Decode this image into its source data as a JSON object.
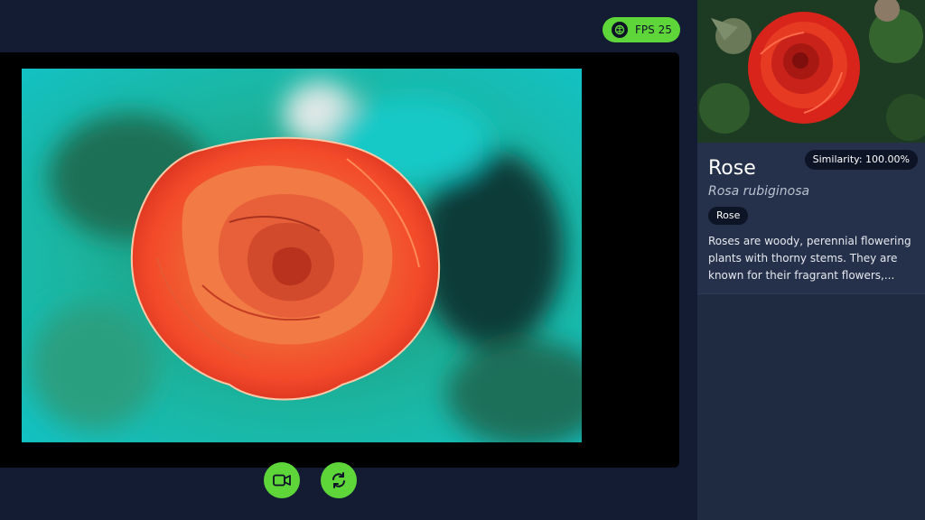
{
  "status": {
    "fps_label": "FPS 25",
    "icon": "brain-icon"
  },
  "controls": {
    "camera_icon": "video-camera-icon",
    "switch_icon": "refresh-icon"
  },
  "result": {
    "similarity": "Similarity: 100.00%",
    "common_name": "Rose",
    "scientific_name": "Rosa rubiginosa",
    "tag": "Rose",
    "description": "Roses are woody, perennial flowering plants with thorny stems. They are known for their fragrant flowers,..."
  },
  "colors": {
    "accent": "#5ed63a",
    "background": "#131c33",
    "panel": "#25314a",
    "pill": "#0d1426"
  }
}
